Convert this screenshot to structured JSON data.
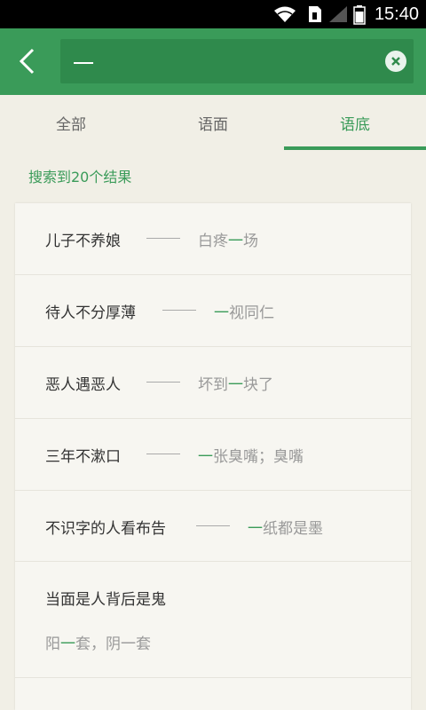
{
  "status_bar": {
    "time": "15:40"
  },
  "header": {
    "search": {
      "value": "一",
      "placeholder": ""
    }
  },
  "tabs": [
    {
      "label": "全部"
    },
    {
      "label": "语面"
    },
    {
      "label": "语底"
    }
  ],
  "result_count": "搜索到20个结果",
  "results": [
    {
      "phrase": "儿子不养娘",
      "answer_pre": "白疼",
      "answer_hl": "一",
      "answer_post": "场"
    },
    {
      "phrase": "待人不分厚薄",
      "answer_pre": "",
      "answer_hl": "一",
      "answer_post": "视同仁"
    },
    {
      "phrase": "恶人遇恶人",
      "answer_pre": "坏到",
      "answer_hl": "一",
      "answer_post": "块了"
    },
    {
      "phrase": "三年不漱口",
      "answer_pre": "",
      "answer_hl": "一",
      "answer_post": "张臭嘴；臭嘴"
    },
    {
      "phrase": "不识字的人看布告",
      "answer_pre": "",
      "answer_hl": "一",
      "answer_post": "纸都是墨"
    },
    {
      "phrase": "当面是人背后是鬼",
      "answer_pre": "阳",
      "answer_hl": "一",
      "answer_post": "套，阴一套"
    }
  ]
}
